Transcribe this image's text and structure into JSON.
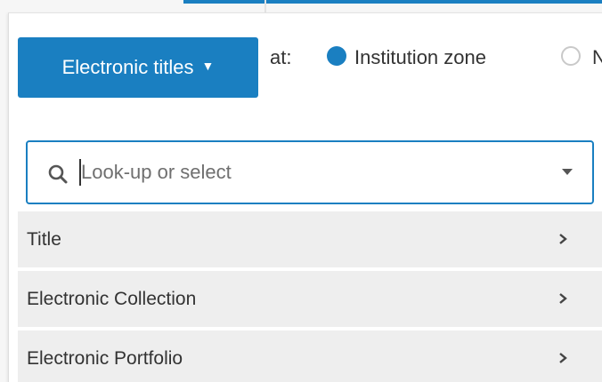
{
  "scope": {
    "button_label": "Electronic titles",
    "caret": "▼"
  },
  "search_location": {
    "label": "at:",
    "options": [
      {
        "label": "Institution zone",
        "selected": true
      },
      {
        "label": "N",
        "selected": false
      }
    ]
  },
  "search": {
    "placeholder": "Look-up or select",
    "value": ""
  },
  "menu": {
    "items": [
      {
        "label": "Title"
      },
      {
        "label": "Electronic Collection"
      },
      {
        "label": "Electronic Portfolio"
      }
    ]
  },
  "colors": {
    "accent": "#1a7fc1",
    "option_bg": "#eeeeee",
    "text": "#333333"
  }
}
